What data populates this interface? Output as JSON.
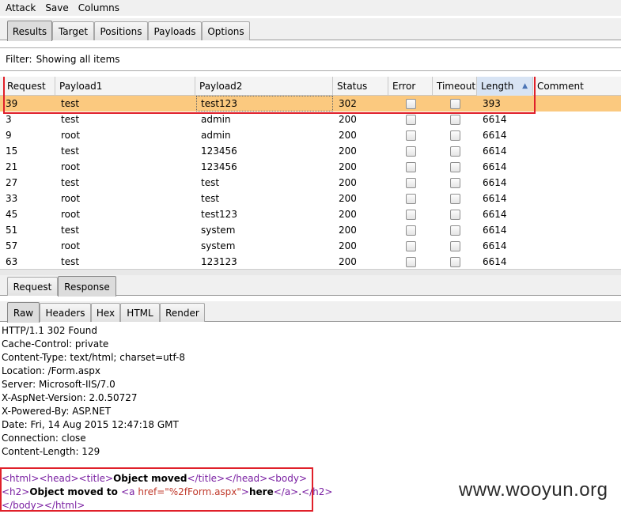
{
  "menu": [
    "Attack",
    "Save",
    "Columns"
  ],
  "main_tabs": [
    "Results",
    "Target",
    "Positions",
    "Payloads",
    "Options"
  ],
  "filter": {
    "label": "Filter:",
    "value": "Showing all items"
  },
  "table": {
    "columns": [
      "Request",
      "Payload1",
      "Payload2",
      "Status",
      "Error",
      "Timeout",
      "Length",
      "Comment"
    ],
    "sort_indicator": "▲",
    "rows": [
      [
        "39",
        "test",
        "test123",
        "302",
        "393"
      ],
      [
        "3",
        "test",
        "admin",
        "200",
        "6614"
      ],
      [
        "9",
        "root",
        "admin",
        "200",
        "6614"
      ],
      [
        "15",
        "test",
        "123456",
        "200",
        "6614"
      ],
      [
        "21",
        "root",
        "123456",
        "200",
        "6614"
      ],
      [
        "27",
        "test",
        "test",
        "200",
        "6614"
      ],
      [
        "33",
        "root",
        "test",
        "200",
        "6614"
      ],
      [
        "45",
        "root",
        "test123",
        "200",
        "6614"
      ],
      [
        "51",
        "test",
        "system",
        "200",
        "6614"
      ],
      [
        "57",
        "root",
        "system",
        "200",
        "6614"
      ],
      [
        "63",
        "test",
        "123123",
        "200",
        "6614"
      ]
    ]
  },
  "req_res_tabs": [
    "Request",
    "Response"
  ],
  "view_tabs": [
    "Raw",
    "Headers",
    "Hex",
    "HTML",
    "Render"
  ],
  "response_headers": [
    "HTTP/1.1 302 Found",
    "Cache-Control: private",
    "Content-Type: text/html; charset=utf-8",
    "Location: /Form.aspx",
    "Server: Microsoft-IIS/7.0",
    "X-AspNet-Version: 2.0.50727",
    "X-Powered-By: ASP.NET",
    "Date: Fri, 14 Aug 2015 12:47:18 GMT",
    "Connection: close",
    "Content-Length: 129"
  ],
  "html_body": {
    "l1": {
      "t1": "<html>",
      "t2": "<head>",
      "t3": "<title>",
      "text": "Object moved",
      "t4": "</title>",
      "t5": "</head>",
      "t6": "<body>"
    },
    "l2": {
      "t1": "<h2>",
      "text": "Object moved to ",
      "t2": "<a ",
      "attr": "href=",
      "val": "\"%2fForm.aspx\"",
      "t3": ">",
      "link": "here",
      "t4": "</a>",
      "dot": ".",
      "t5": "</h2>"
    },
    "l3": {
      "t1": "</body>",
      "t2": "</html>"
    }
  },
  "watermark": "www.wooyun.org",
  "colors": {
    "selected_row": "#fbc97f",
    "highlight_box": "#e0202a",
    "tag": "#7a1fa2"
  }
}
